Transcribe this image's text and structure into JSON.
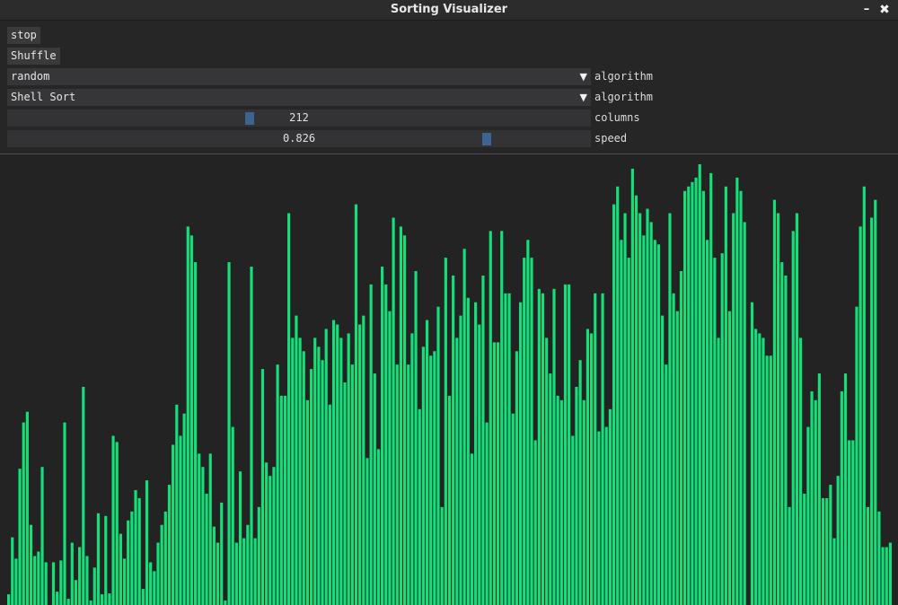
{
  "window": {
    "title": "Sorting Visualizer",
    "minimize_icon": "–",
    "close_icon": "✖"
  },
  "controls": {
    "stop_label": "stop",
    "shuffle_label": "Shuffle",
    "data_pattern": {
      "value": "random",
      "label": "algorithm",
      "arrow": "▼"
    },
    "sort_algorithm": {
      "value": "Shell Sort",
      "label": "algorithm",
      "arrow": "▼"
    },
    "columns": {
      "value": "212",
      "label": "columns",
      "level": 0.414
    },
    "speed": {
      "value": "0.826",
      "label": "speed",
      "level": 0.826
    }
  },
  "colors": {
    "bar": "#14e07a",
    "background": "#232323",
    "slider_grab": "#3d6490"
  },
  "chart_data": {
    "type": "bar",
    "max_value": 500,
    "values": [
      12,
      76,
      52,
      153,
      205,
      217,
      90,
      55,
      60,
      155,
      48,
      0,
      48,
      15,
      50,
      205,
      7,
      70,
      28,
      65,
      245,
      55,
      5,
      42,
      103,
      12,
      100,
      13,
      190,
      183,
      80,
      52,
      95,
      105,
      129,
      120,
      18,
      140,
      48,
      38,
      70,
      90,
      105,
      135,
      180,
      225,
      190,
      215,
      425,
      415,
      385,
      170,
      155,
      125,
      170,
      88,
      70,
      115,
      5,
      385,
      200,
      70,
      150,
      75,
      90,
      380,
      75,
      110,
      265,
      160,
      145,
      155,
      270,
      235,
      235,
      440,
      300,
      325,
      300,
      285,
      230,
      265,
      300,
      290,
      275,
      310,
      225,
      320,
      315,
      300,
      250,
      305,
      270,
      450,
      315,
      325,
      165,
      360,
      260,
      175,
      380,
      360,
      330,
      435,
      270,
      425,
      415,
      270,
      305,
      375,
      220,
      290,
      320,
      280,
      285,
      335,
      110,
      390,
      235,
      370,
      300,
      325,
      400,
      345,
      170,
      340,
      315,
      370,
      205,
      420,
      295,
      295,
      420,
      350,
      350,
      215,
      285,
      340,
      390,
      410,
      390,
      185,
      355,
      350,
      300,
      260,
      355,
      235,
      230,
      360,
      360,
      190,
      245,
      275,
      230,
      310,
      305,
      350,
      195,
      350,
      200,
      220,
      450,
      470,
      410,
      440,
      390,
      490,
      460,
      440,
      415,
      445,
      430,
      410,
      405,
      325,
      270,
      440,
      350,
      330,
      375,
      465,
      470,
      475,
      480,
      495,
      465,
      410,
      485,
      390,
      300,
      395,
      470,
      330,
      440,
      480,
      465,
      430,
      0,
      340,
      310,
      305,
      300,
      280,
      280,
      455,
      440,
      385,
      370,
      110,
      420,
      440,
      300,
      125,
      200,
      240,
      230,
      260,
      120,
      120,
      135,
      75,
      145,
      240,
      260,
      185,
      185,
      335,
      425,
      470,
      110,
      435,
      455,
      105,
      65,
      65,
      70
    ]
  }
}
